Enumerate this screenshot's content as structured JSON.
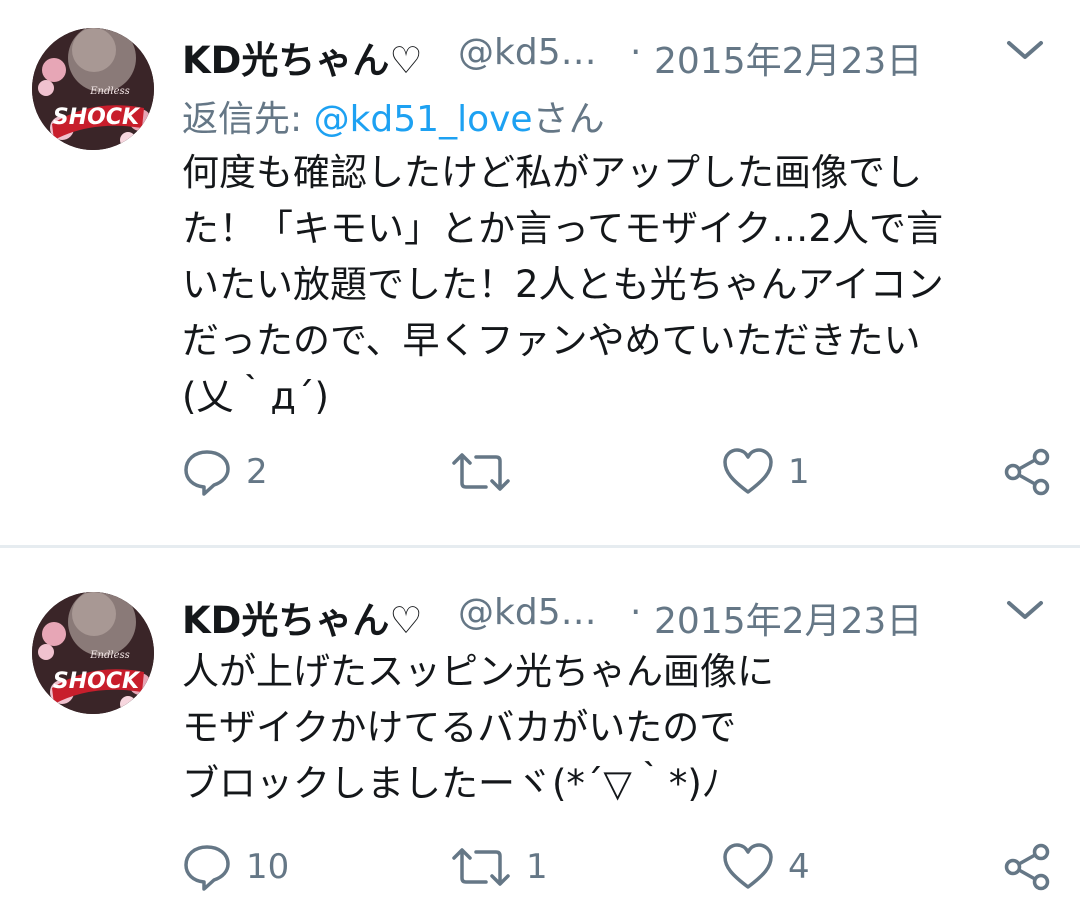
{
  "tweets": [
    {
      "name": "KD光ちゃん♡",
      "handle": "@kd5…",
      "separator": "·",
      "date": "2015年2月23日",
      "reply_prefix": "返信先: ",
      "reply_mention": "@kd51_love",
      "reply_suffix": "さん",
      "lines": [
        "何度も確認したけど私がアップした画像でし",
        "た！「キモい」とか言ってモザイク…2人で言",
        "いたい放題でした！2人とも光ちゃんアイコン",
        "だったので、早くファンやめていただきたい",
        "(乂｀д´)"
      ],
      "reply_count": "2",
      "retweet_count": "",
      "like_count": "1"
    },
    {
      "name": "KD光ちゃん♡",
      "handle": "@kd5…",
      "separator": "·",
      "date": "2015年2月23日",
      "lines": [
        "人が上げたスッピン光ちゃん画像に",
        "モザイクかけてるバカがいたので",
        "ブロックしましたーヾ(*´▽｀*)ﾉ"
      ],
      "reply_count": "10",
      "retweet_count": "1",
      "like_count": "4"
    }
  ],
  "avatar": {
    "logo_text": "SHOCK",
    "logo_sub": "Endless"
  },
  "icons": {
    "reply": "speech-bubble-icon",
    "retweet": "retweet-arrows-icon",
    "like": "heart-outline-icon",
    "share": "share-nodes-icon",
    "more": "chevron-down-icon"
  },
  "colors": {
    "text": "#14171a",
    "secondary": "#657786",
    "link": "#1da1f2",
    "divider": "#e6ecf0"
  }
}
